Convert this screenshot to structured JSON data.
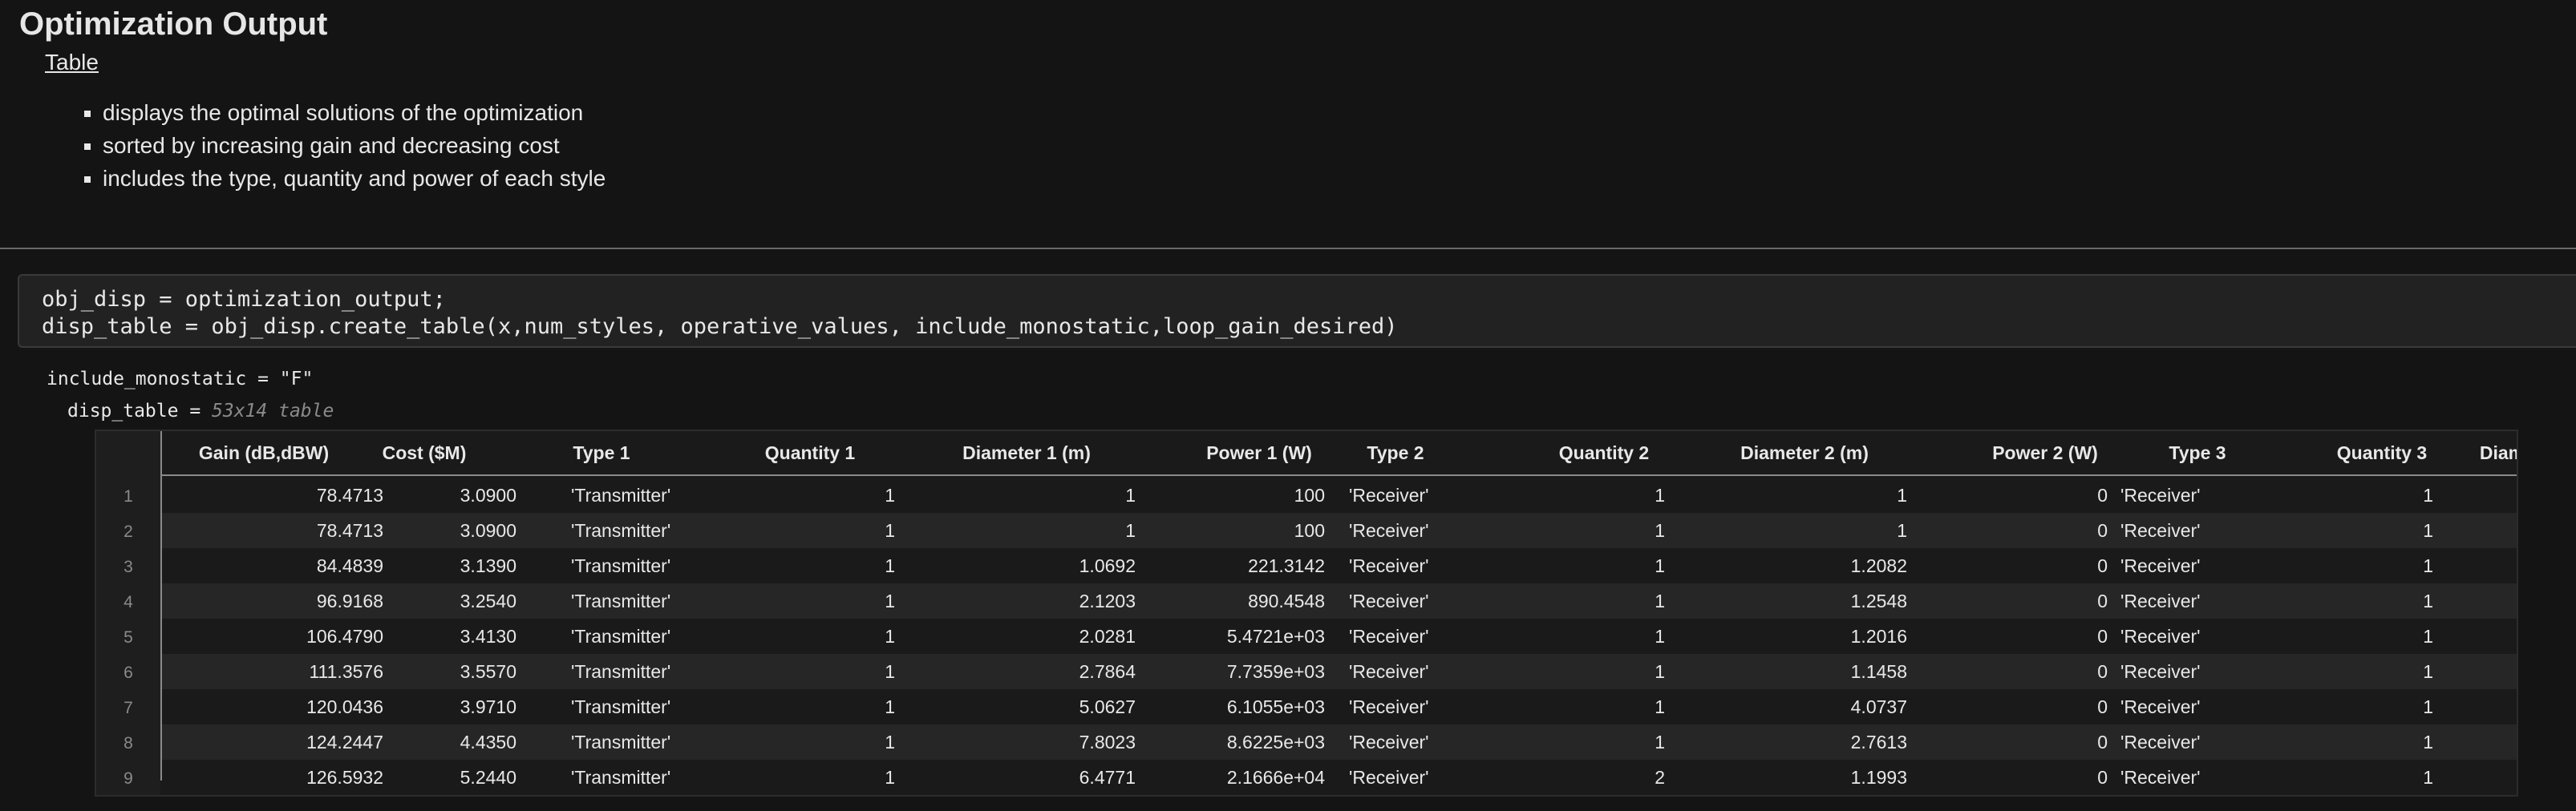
{
  "page": {
    "title": "Optimization Output",
    "link": "Table",
    "bullets": [
      "displays the optimal solutions of the optimization",
      "sorted by increasing gain and decreasing cost",
      "includes the type, quantity and power of each style"
    ]
  },
  "code": {
    "lines": [
      "obj_disp = optimization_output;",
      "disp_table = obj_disp.create_table(x,num_styles, operative_values, include_monostatic,loop_gain_desired)"
    ]
  },
  "output": {
    "var_line": "include_monostatic = \"F\"",
    "table_name": "disp_table = ",
    "table_size": "53x14 table"
  },
  "table": {
    "headers": [
      "Gain (dB,dBW)",
      "Cost ($M)",
      "Type 1",
      "Quantity 1",
      "Diameter 1 (m)",
      "Power 1 (W)",
      "Type 2",
      "Quantity 2",
      "Diameter 2 (m)",
      "Power 2 (W)",
      "Type 3",
      "Quantity 3",
      "Diam"
    ],
    "rows": [
      [
        "1",
        "78.4713",
        "3.0900",
        "'Transmitter'",
        "1",
        "1",
        "100",
        "'Receiver'",
        "1",
        "1",
        "0",
        "'Receiver'",
        "1"
      ],
      [
        "2",
        "78.4713",
        "3.0900",
        "'Transmitter'",
        "1",
        "1",
        "100",
        "'Receiver'",
        "1",
        "1",
        "0",
        "'Receiver'",
        "1"
      ],
      [
        "3",
        "84.4839",
        "3.1390",
        "'Transmitter'",
        "1",
        "1.0692",
        "221.3142",
        "'Receiver'",
        "1",
        "1.2082",
        "0",
        "'Receiver'",
        "1"
      ],
      [
        "4",
        "96.9168",
        "3.2540",
        "'Transmitter'",
        "1",
        "2.1203",
        "890.4548",
        "'Receiver'",
        "1",
        "1.2548",
        "0",
        "'Receiver'",
        "1"
      ],
      [
        "5",
        "106.4790",
        "3.4130",
        "'Transmitter'",
        "1",
        "2.0281",
        "5.4721e+03",
        "'Receiver'",
        "1",
        "1.2016",
        "0",
        "'Receiver'",
        "1"
      ],
      [
        "6",
        "111.3576",
        "3.5570",
        "'Transmitter'",
        "1",
        "2.7864",
        "7.7359e+03",
        "'Receiver'",
        "1",
        "1.1458",
        "0",
        "'Receiver'",
        "1"
      ],
      [
        "7",
        "120.0436",
        "3.9710",
        "'Transmitter'",
        "1",
        "5.0627",
        "6.1055e+03",
        "'Receiver'",
        "1",
        "4.0737",
        "0",
        "'Receiver'",
        "1"
      ],
      [
        "8",
        "124.2447",
        "4.4350",
        "'Transmitter'",
        "1",
        "7.8023",
        "8.6225e+03",
        "'Receiver'",
        "1",
        "2.7613",
        "0",
        "'Receiver'",
        "1"
      ],
      [
        "9",
        "126.5932",
        "5.2440",
        "'Transmitter'",
        "1",
        "6.4771",
        "2.1666e+04",
        "'Receiver'",
        "2",
        "1.1993",
        "0",
        "'Receiver'",
        "1"
      ]
    ]
  }
}
